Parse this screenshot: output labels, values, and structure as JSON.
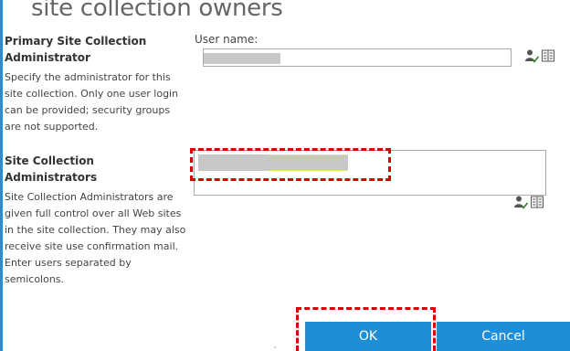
{
  "page": {
    "title": "site collection owners"
  },
  "primary_admin": {
    "heading": "Primary Site Collection Administrator",
    "description": "Specify the administrator for this site collection. Only one user login can be provided; security groups are not supported.",
    "field_label": "User name:",
    "value": ""
  },
  "site_admins": {
    "heading": "Site Collection Administrators",
    "description": "Site Collection Administrators are given full control over all Web sites in the site collection. They may also receive site use confirmation mail. Enter users separated by semicolons.",
    "value": ""
  },
  "buttons": {
    "ok_label": "OK",
    "cancel_label": "Cancel"
  },
  "icons": {
    "check_names": "check-names-icon",
    "browse": "address-book-icon"
  },
  "colors": {
    "accent": "#1e8fd6",
    "highlight": "#d80000",
    "left_rule": "#2a8dd4"
  }
}
